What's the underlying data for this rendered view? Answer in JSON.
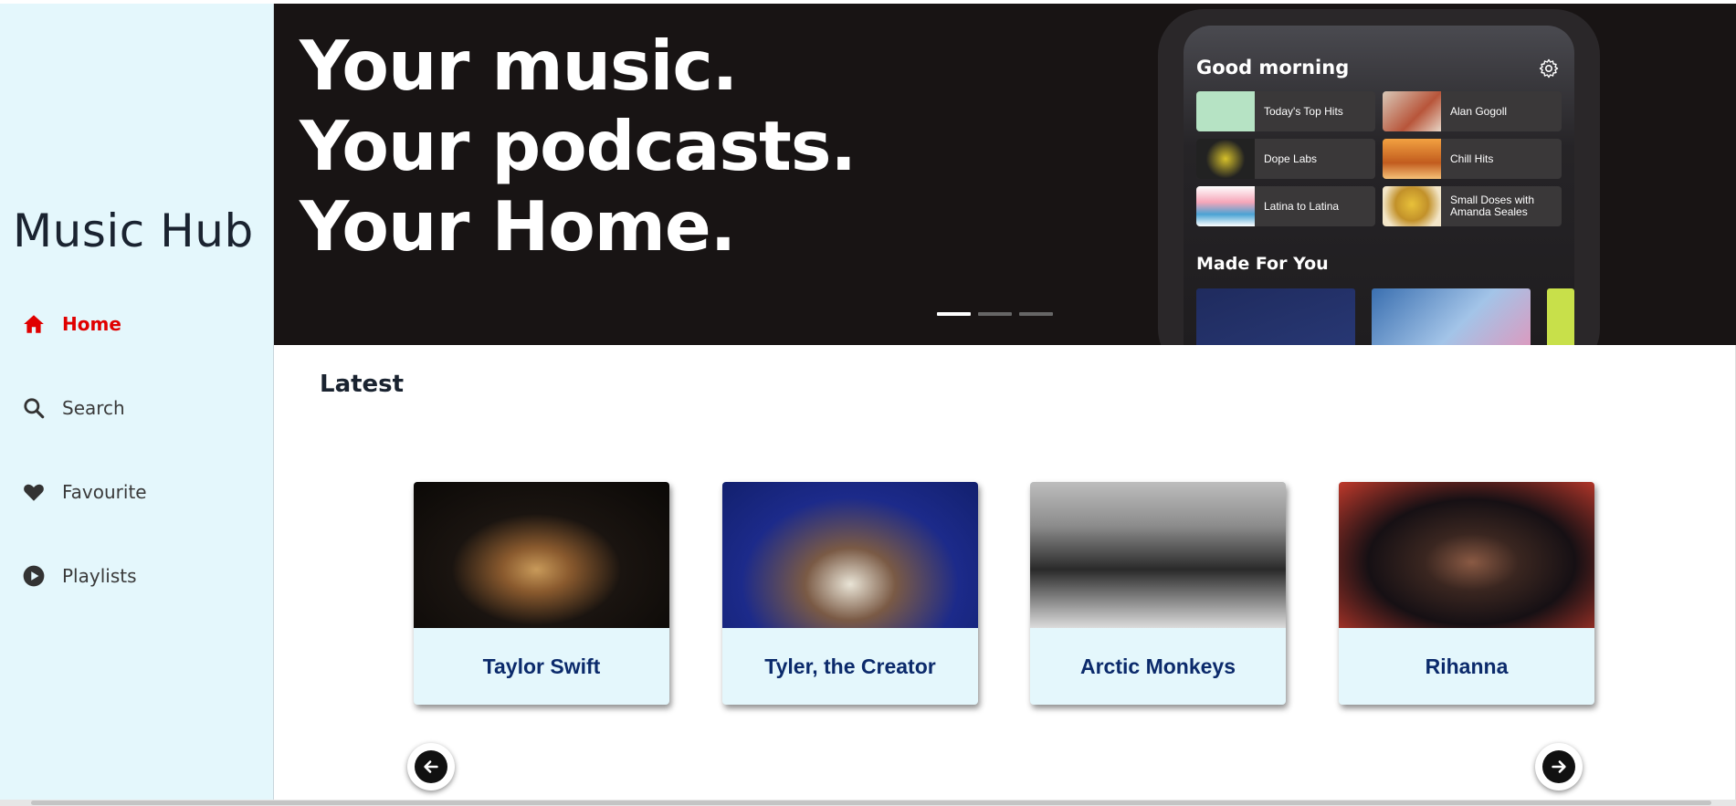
{
  "app": {
    "brand": "Music Hub"
  },
  "nav": [
    {
      "label": "Home",
      "icon": "home-icon",
      "active": true
    },
    {
      "label": "Search",
      "icon": "search-icon",
      "active": false
    },
    {
      "label": "Favourite",
      "icon": "heart-icon",
      "active": false
    },
    {
      "label": "Playlists",
      "icon": "play-circle-icon",
      "active": false
    }
  ],
  "hero": {
    "lines": [
      "Your music.",
      "Your podcasts.",
      "Your Home."
    ],
    "slides": 3,
    "active_slide": 0,
    "phone": {
      "greeting": "Good morning",
      "tiles": [
        "Today's Top Hits",
        "Alan Gogoll",
        "Dope Labs",
        "Chill Hits",
        "Latina to Latina",
        "Small Doses with Amanda Seales"
      ],
      "section": "Made For You"
    }
  },
  "section_title": "Latest",
  "artists": [
    {
      "name": "Taylor Swift"
    },
    {
      "name": "Tyler, the Creator"
    },
    {
      "name": "Arctic Monkeys"
    },
    {
      "name": "Rihanna"
    }
  ],
  "colors": {
    "active_nav": "#e00000",
    "sidebar_bg": "#e4f7fc",
    "card_name": "#0b2a6b",
    "hero_bg": "#181414"
  }
}
